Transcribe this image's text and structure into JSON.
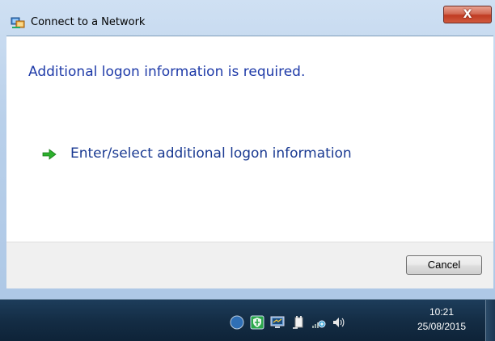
{
  "window": {
    "title": "Connect to a Network",
    "close_label": "X"
  },
  "content": {
    "heading": "Additional logon information is required.",
    "link_text": "Enter/select additional logon information"
  },
  "footer": {
    "cancel_label": "Cancel"
  },
  "taskbar": {
    "time": "10:21",
    "date": "25/08/2015",
    "tray_icons": [
      "moon-icon",
      "shield-icon",
      "monitor-icon",
      "power-icon",
      "network-icon",
      "volume-icon"
    ]
  },
  "colors": {
    "heading_blue": "#1e3aa8",
    "link_blue": "#1a3a92",
    "arrow_green": "#2db12d"
  }
}
